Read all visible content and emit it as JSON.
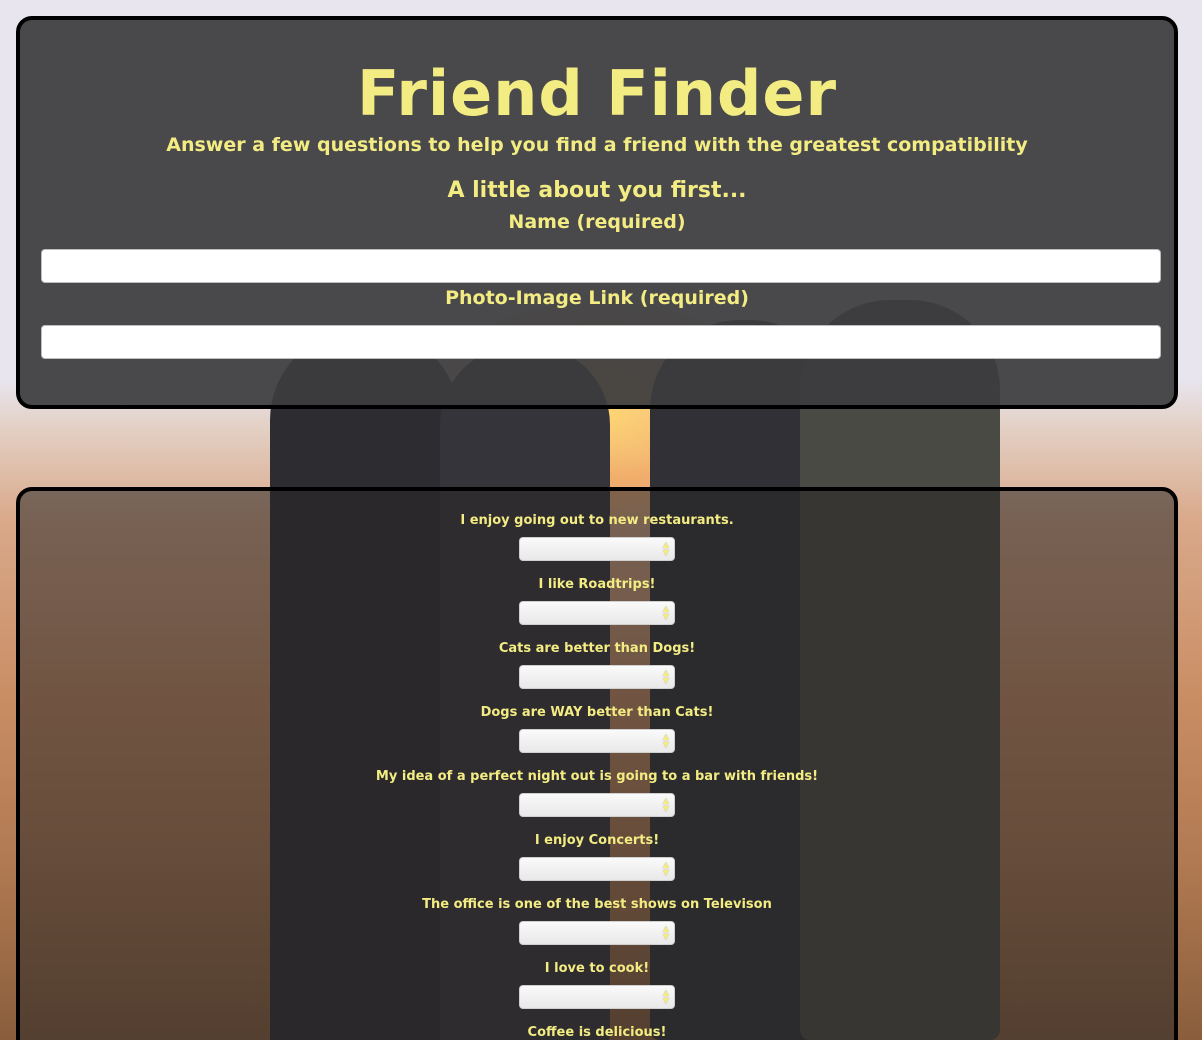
{
  "header": {
    "title": "Friend Finder",
    "subtitle": "Answer a few questions to help you find a friend with the greatest compatibility"
  },
  "about": {
    "heading": "A little about you first...",
    "name_label": "Name (required)",
    "name_value": "",
    "photo_label": "Photo-Image Link (required)",
    "photo_value": ""
  },
  "questions": [
    {
      "text": "I enjoy going out to new restaurants.",
      "value": ""
    },
    {
      "text": "I like Roadtrips!",
      "value": ""
    },
    {
      "text": "Cats are better than Dogs!",
      "value": ""
    },
    {
      "text": "Dogs are WAY better than Cats!",
      "value": ""
    },
    {
      "text": "My idea of a perfect night out is going to a bar with friends!",
      "value": ""
    },
    {
      "text": "I enjoy Concerts!",
      "value": ""
    },
    {
      "text": "The office is one of the best shows on Televison",
      "value": ""
    },
    {
      "text": "I love to cook!",
      "value": ""
    },
    {
      "text": "Coffee is delicious!",
      "value": ""
    }
  ],
  "colors": {
    "accent": "#f3ec83",
    "panel": "#3c3c3e",
    "border": "#000000"
  },
  "icons": {
    "select_arrows": "chevron-up-down-icon"
  }
}
